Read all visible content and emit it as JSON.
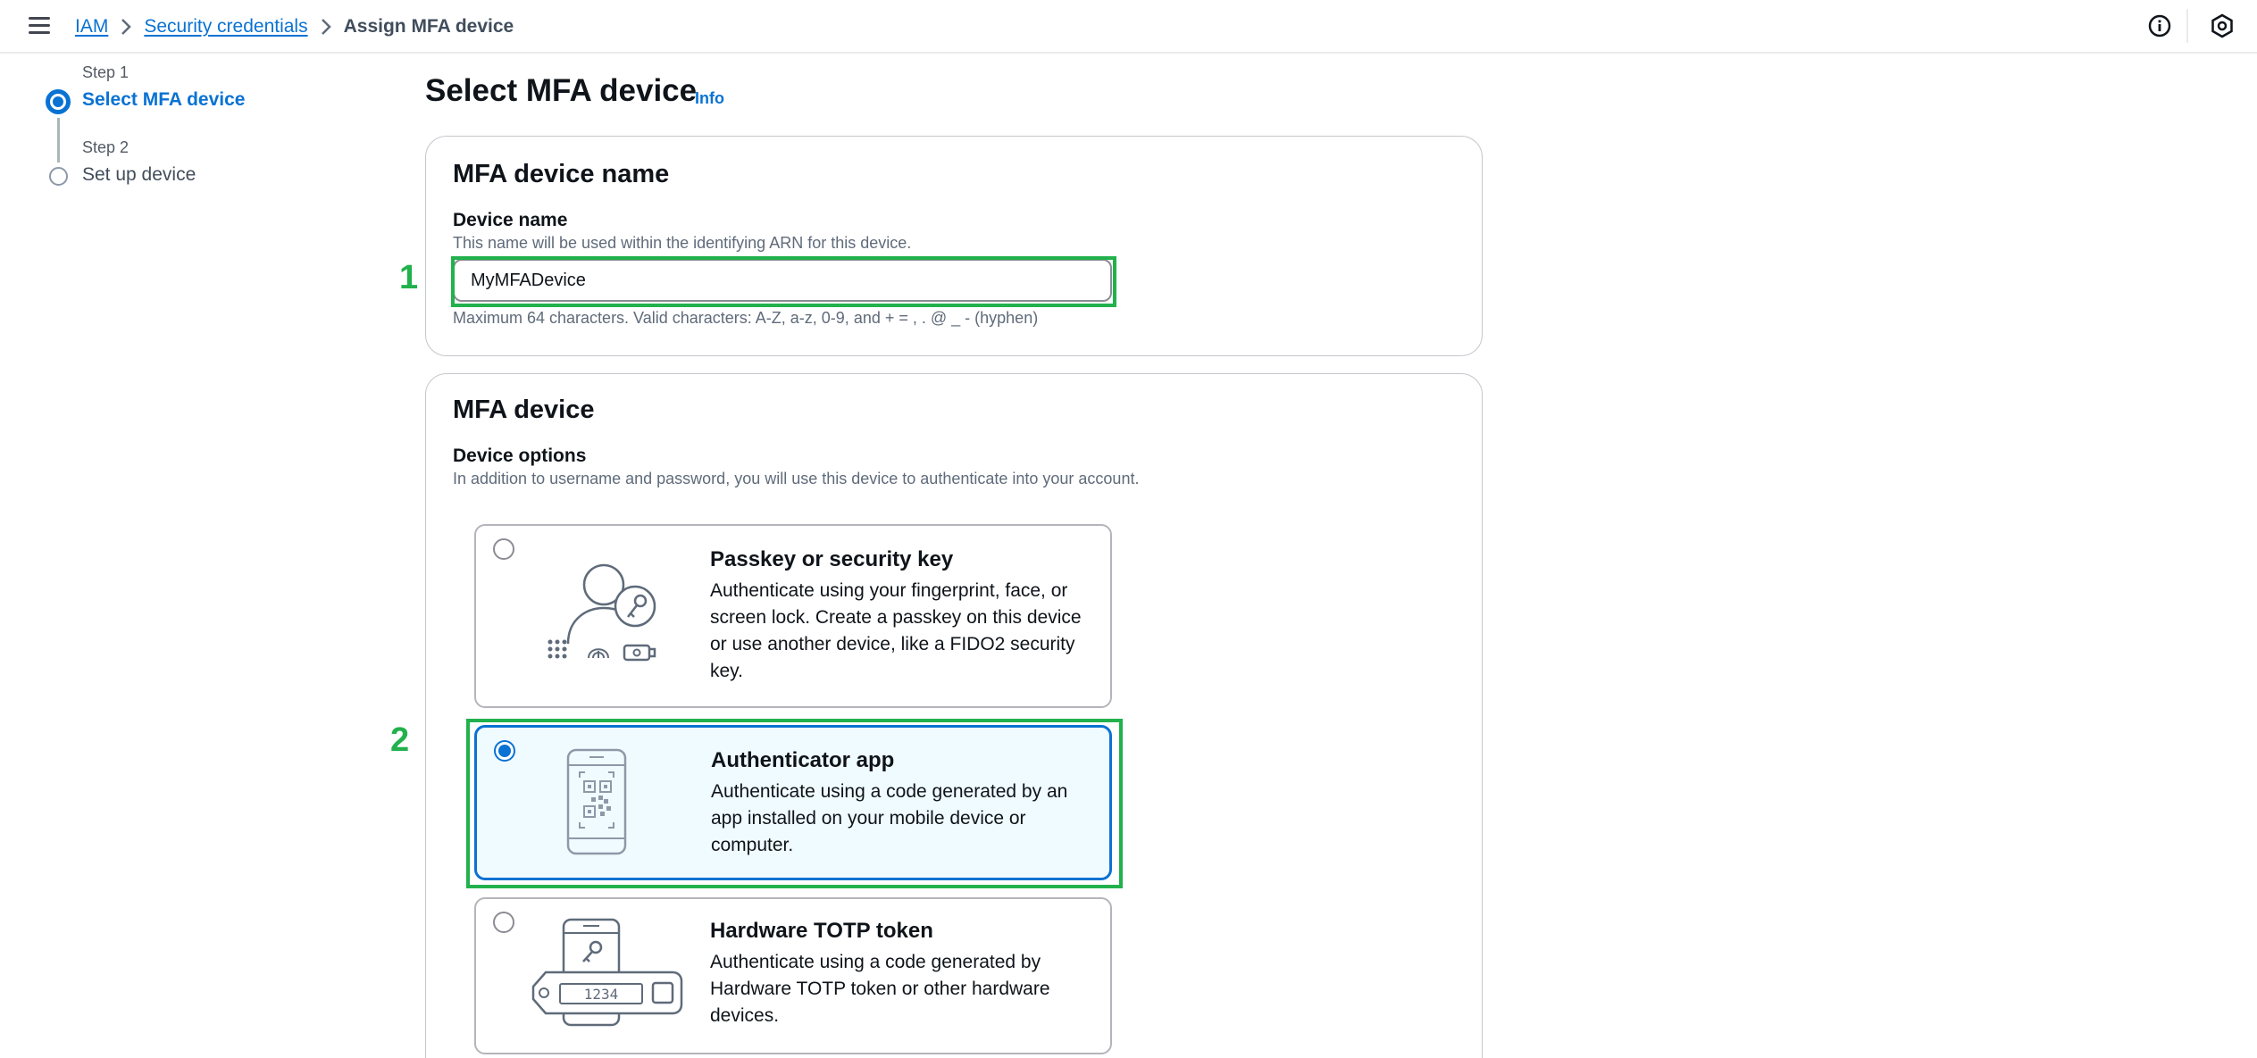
{
  "breadcrumb": {
    "items": [
      "IAM",
      "Security credentials"
    ],
    "current": "Assign MFA device"
  },
  "steps": [
    {
      "label": "Step 1",
      "title": "Select MFA device",
      "state": "active"
    },
    {
      "label": "Step 2",
      "title": "Set up device",
      "state": "inactive"
    }
  ],
  "page": {
    "title": "Select MFA device",
    "info": "Info"
  },
  "name_panel": {
    "heading": "MFA device name",
    "field_label": "Device name",
    "field_desc": "This name will be used within the identifying ARN for this device.",
    "value": "MyMFADevice",
    "constraint": "Maximum 64 characters. Valid characters: A-Z, a-z, 0-9, and + = , . @ _ - (hyphen)"
  },
  "device_panel": {
    "heading": "MFA device",
    "field_label": "Device options",
    "field_desc": "In addition to username and password, you will use this device to authenticate into your account.",
    "options": [
      {
        "title": "Passkey or security key",
        "desc": "Authenticate using your fingerprint, face, or screen lock. Create a passkey on this device or use another device, like a FIDO2 security key.",
        "selected": false,
        "icon": "passkey-icon"
      },
      {
        "title": "Authenticator app",
        "desc": "Authenticate using a code generated by an app installed on your mobile device or computer.",
        "selected": true,
        "icon": "authenticator-app-icon"
      },
      {
        "title": "Hardware TOTP token",
        "desc": "Authenticate using a code generated by Hardware TOTP token or other hardware devices.",
        "selected": false,
        "icon": "hardware-token-icon",
        "token_digits": "1234"
      }
    ]
  },
  "annotations": {
    "marker_1": "1",
    "marker_2": "2",
    "highlight_color": "#22b14c"
  },
  "colors": {
    "accent": "#0972d3",
    "selected_bg": "#f0fbff"
  }
}
